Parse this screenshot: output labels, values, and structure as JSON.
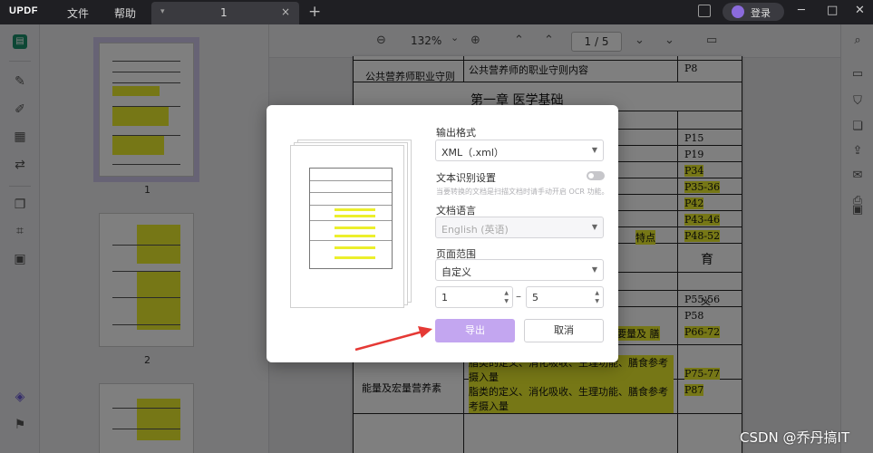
{
  "titlebar": {
    "logo": "UPDF",
    "menu": [
      "文件",
      "帮助"
    ],
    "tab_title": "1",
    "tab_close": "×",
    "tab_add": "+",
    "login": "登录",
    "window_controls": [
      "─",
      "□",
      "✕"
    ]
  },
  "toolbar": {
    "zoom_out": "⊖",
    "zoom": "132%",
    "zoom_caret": "⌄",
    "zoom_in": "⊕",
    "first_page": "⌃",
    "prev_page": "⌃",
    "page_display": "1 / 5",
    "next_page": "⌄",
    "last_page": "⌄",
    "comment": "▭"
  },
  "thumbnails": [
    {
      "number": "1"
    },
    {
      "number": "2"
    }
  ],
  "document": {
    "rows": [
      {
        "left": "公共营养师职业守则",
        "mid": "公共营养师的职业守则内容",
        "right": "P8"
      },
      {
        "heading": "第一章  医学基础"
      },
      {
        "right": "P15"
      },
      {
        "right": "P19"
      },
      {
        "right": "P34"
      },
      {
        "right": "P35-36"
      },
      {
        "right": "P42"
      },
      {
        "right": "P43-46"
      },
      {
        "mid": "特点",
        "right": "P48-52"
      },
      {
        "heading": "育"
      },
      {
        "mid": "义",
        "right": "P55-56"
      },
      {
        "right": "P58"
      },
      {
        "mid": "需要量及 膳",
        "right": "P66-72"
      },
      {
        "left": "能量及宏量营养素",
        "mid": "脂类的定义、消化吸收、生理功能、膳食参考 摄入量",
        "right": "P75-77"
      },
      {
        "mid": "脂类的定义、消化吸收、生理功能、膳食参考 考摄入量",
        "right": "P87"
      }
    ]
  },
  "dialog": {
    "output_format_label": "输出格式",
    "output_format_value": "XML（.xml）",
    "ocr_label": "文本识别设置",
    "ocr_hint": "当要转换的文档是扫描文档时请手动开启 OCR 功能。",
    "doc_lang_label": "文档语言",
    "doc_lang_value": "English (英语)",
    "page_range_label": "页面范围",
    "page_range_value": "自定义",
    "range_from": "1",
    "range_to": "5",
    "range_sep": "–",
    "export": "导出",
    "cancel": "取消"
  },
  "watermark": "CSDN @乔丹搞IT",
  "colors": {
    "accent": "#c3a6f0",
    "highlight": "#ecef2c",
    "arrow": "#e53935"
  }
}
